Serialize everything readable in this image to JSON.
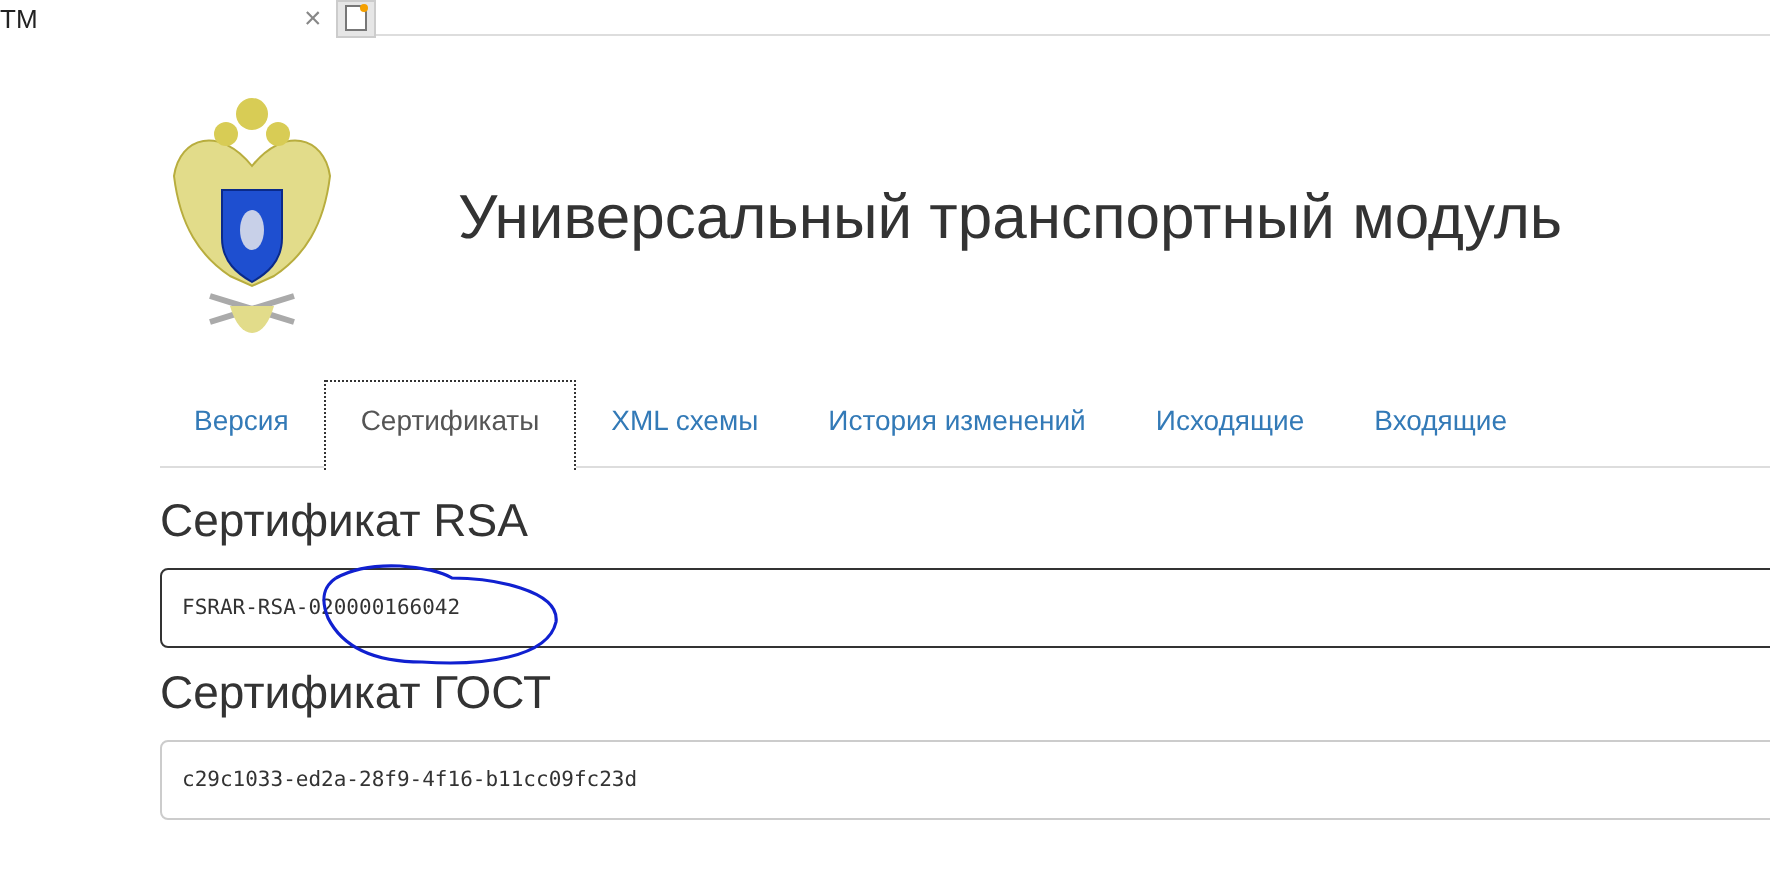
{
  "browser_tab": {
    "title": "ТМ",
    "close": "×"
  },
  "header": {
    "title": "Универсальный транспортный модуль"
  },
  "tabs": [
    {
      "label": "Версия",
      "selected": false
    },
    {
      "label": "Сертификаты",
      "selected": true
    },
    {
      "label": "XML схемы",
      "selected": false
    },
    {
      "label": "История изменений",
      "selected": false
    },
    {
      "label": "Исходящие",
      "selected": false
    },
    {
      "label": "Входящие",
      "selected": false
    }
  ],
  "sections": [
    {
      "heading": "Сертификат RSA",
      "value": "FSRAR-RSA-020000166042",
      "focused": true,
      "circled": true
    },
    {
      "heading": "Сертификат ГОСТ",
      "value": "c29c1033-ed2a-28f9-4f16-b11cc09fc23d",
      "focused": false,
      "circled": false
    }
  ]
}
